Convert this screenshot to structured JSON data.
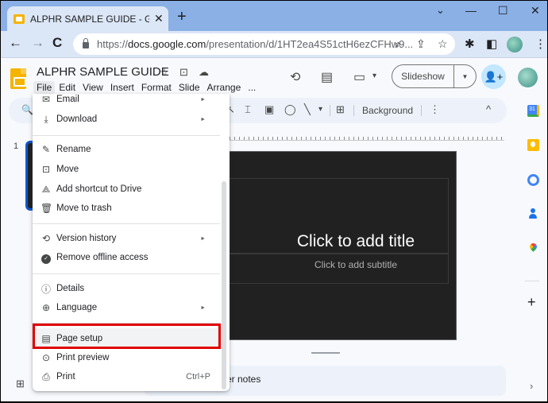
{
  "browser": {
    "tab_title": "ALPHR SAMPLE GUIDE - Google",
    "tab_close": "✕",
    "new_tab": "+",
    "window_controls": {
      "dropdown": "⌄",
      "minimize": "—",
      "maximize": "☐",
      "close": "✕"
    },
    "nav": {
      "back": "←",
      "forward": "→",
      "reload": "C"
    },
    "url_host": "docs.google.com",
    "url_prefix": "https://",
    "url_path": "/presentation/d/1HT2ea4S51ctH6ezCFHw9...",
    "omnibox_icons": {
      "zoom": "⌕",
      "share": "⇪",
      "bookmark": "☆"
    },
    "toolbar_icons": {
      "extensions": "✱",
      "sidepanel": "◧",
      "menu": "⋮"
    }
  },
  "doc": {
    "title": "ALPHR SAMPLE GUIDE",
    "title_icons": {
      "star": "☆",
      "move": "⊡",
      "cloud": "☁"
    },
    "menus": [
      "File",
      "Edit",
      "View",
      "Insert",
      "Format",
      "Slide",
      "Arrange",
      "..."
    ],
    "header_icons": {
      "history": "⟲",
      "comments": "▤",
      "meet": "▭",
      "meet_drop": "▾"
    },
    "slideshow_label": "Slideshow",
    "slideshow_drop": "▼",
    "share_icon": "👤+"
  },
  "edit_toolbar": {
    "search": "🔍",
    "icons": {
      "select": "↖",
      "textbox": "⌶",
      "image": "▣",
      "shape": "◯",
      "line": "╲",
      "line_drop": "▾",
      "comment": "⊞",
      "more": "⋮",
      "collapse": "^"
    },
    "background_label": "Background"
  },
  "filmstrip": {
    "slide_number": "1",
    "grid_icon": "⊞"
  },
  "slide": {
    "title_placeholder": "Click to add title",
    "subtitle_placeholder": "Click to add subtitle"
  },
  "notes": {
    "placeholder": "Click to add speaker notes",
    "visible_text": "er notes"
  },
  "side_panel": {
    "calendar_label": "31",
    "add": "+",
    "expand": "›"
  },
  "file_menu": {
    "items": [
      {
        "label": "Email",
        "icon": "✉",
        "submenu": true
      },
      {
        "label": "Download",
        "icon": "⤓",
        "submenu": true
      },
      {
        "label": "Rename",
        "icon": "✎",
        "submenu": false
      },
      {
        "label": "Move",
        "icon": "⊡",
        "submenu": false
      },
      {
        "label": "Add shortcut to Drive",
        "icon": "⟁",
        "submenu": false
      },
      {
        "label": "Move to trash",
        "icon": "🗑",
        "submenu": false
      },
      {
        "label": "Version history",
        "icon": "⟲",
        "submenu": true
      },
      {
        "label": "Remove offline access",
        "icon": "✓",
        "submenu": false
      },
      {
        "label": "Details",
        "icon": "ⓘ",
        "submenu": false
      },
      {
        "label": "Language",
        "icon": "⊕",
        "submenu": true
      },
      {
        "label": "Page setup",
        "icon": "▤",
        "submenu": false,
        "highlighted": true
      },
      {
        "label": "Print preview",
        "icon": "⊙",
        "submenu": false
      },
      {
        "label": "Print",
        "icon": "⎙",
        "submenu": false,
        "shortcut": "Ctrl+P"
      }
    ],
    "submenu_arrow": "►"
  },
  "colors": {
    "highlight_outline": "#e00000",
    "tab_strip": "#8ab0e6",
    "slide_bg": "#212121",
    "accent_blue": "#0b57d0"
  }
}
